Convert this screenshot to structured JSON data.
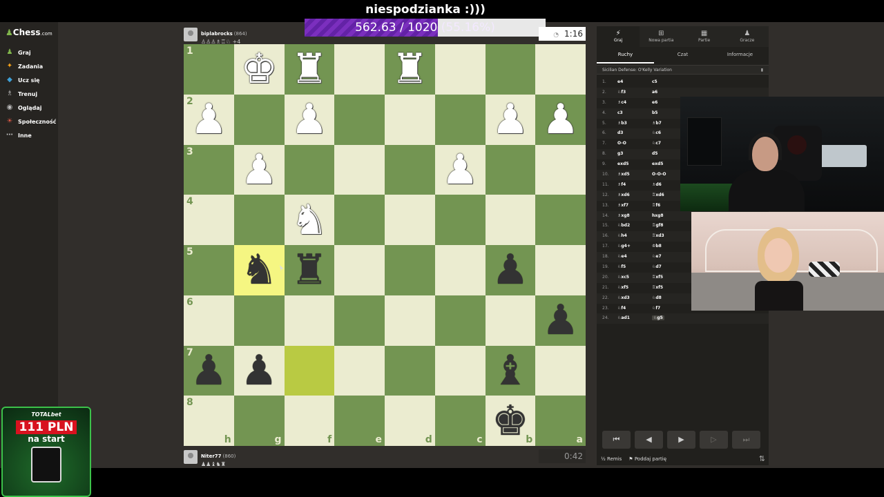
{
  "stream": {
    "caption": "niespodzianka :)))",
    "goal_text": "562.63 / 1020",
    "goal_pct": "(55.16%)",
    "goal_fraction": 0.5516
  },
  "sidebar": {
    "logo": "Chess",
    "logo_suffix": ".com",
    "items": [
      {
        "label": "Graj",
        "icon": "play-pawn-icon"
      },
      {
        "label": "Zadania",
        "icon": "puzzle-icon"
      },
      {
        "label": "Ucz się",
        "icon": "learn-icon"
      },
      {
        "label": "Trenuj",
        "icon": "train-icon"
      },
      {
        "label": "Oglądaj",
        "icon": "watch-icon"
      },
      {
        "label": "Społeczność",
        "icon": "community-icon"
      },
      {
        "label": "Inne",
        "icon": "more-icon"
      }
    ]
  },
  "ad": {
    "brand": "TOTALbet",
    "amount": "111 PLN",
    "sub": "na start"
  },
  "top_player": {
    "name": "biplabrocks",
    "rating": "(864)",
    "captured": "♙♙♙♗♖♘ +4",
    "clock": "1:16"
  },
  "bottom_player": {
    "name": "Niter77",
    "rating": "(860)",
    "captured": "♟♟♝♞♜",
    "clock": "0:42"
  },
  "board": {
    "ranks": [
      "1",
      "2",
      "3",
      "4",
      "5",
      "6",
      "7",
      "8"
    ],
    "files": [
      "h",
      "g",
      "f",
      "e",
      "d",
      "c",
      "b",
      "a"
    ],
    "rows": [
      [
        "",
        "wK",
        "wR",
        "",
        "wR",
        "",
        "",
        ""
      ],
      [
        "wP",
        "",
        "wP",
        "",
        "",
        "",
        "wP",
        "wP"
      ],
      [
        "",
        "wP",
        "",
        "",
        "",
        "wP",
        "",
        ""
      ],
      [
        "",
        "",
        "wN",
        "",
        "",
        "",
        "",
        ""
      ],
      [
        "",
        "bN",
        "bR",
        "",
        "",
        "",
        "bP",
        ""
      ],
      [
        "",
        "",
        "",
        "",
        "",
        "",
        "",
        "bP"
      ],
      [
        "bP",
        "bP",
        "",
        "",
        "",
        "",
        "bB",
        ""
      ],
      [
        "",
        "",
        "",
        "",
        "",
        "",
        "bK",
        ""
      ]
    ],
    "highlight": [
      [
        4,
        1
      ],
      [
        6,
        2
      ]
    ]
  },
  "panel": {
    "tabs": [
      {
        "label": "Graj",
        "icon": "bolt-icon"
      },
      {
        "label": "Nowa partia",
        "icon": "plus-icon"
      },
      {
        "label": "Partie",
        "icon": "board-icon"
      },
      {
        "label": "Gracze",
        "icon": "players-icon"
      }
    ],
    "subtabs": [
      "Ruchy",
      "Czat",
      "Informacje"
    ],
    "opening": "Sicilian Defense: O'Kelly Variation",
    "moves": [
      [
        "1.",
        "e4",
        "c5"
      ],
      [
        "2.",
        "♘f3",
        "a6"
      ],
      [
        "3.",
        "♗c4",
        "e6"
      ],
      [
        "4.",
        "c3",
        "b5"
      ],
      [
        "5.",
        "♗b3",
        "♗b7"
      ],
      [
        "6.",
        "d3",
        "♘c6"
      ],
      [
        "7.",
        "O-O",
        "♘c7"
      ],
      [
        "8.",
        "g3",
        "d5"
      ],
      [
        "9.",
        "exd5",
        "exd5"
      ],
      [
        "10.",
        "♗xd5",
        "O-O-O"
      ],
      [
        "11.",
        "♗f4",
        "♗d6"
      ],
      [
        "12.",
        "♗xd6",
        "♖xd6"
      ],
      [
        "13.",
        "♗xf7",
        "♖f6"
      ],
      [
        "14.",
        "♗xg8",
        "hxg8"
      ],
      [
        "15.",
        "♘bd2",
        "♖gf8"
      ],
      [
        "16.",
        "♘h4",
        "♖xd3"
      ],
      [
        "17.",
        "♘g4+",
        "♔b8"
      ],
      [
        "18.",
        "♘e4",
        "♘e7"
      ],
      [
        "19.",
        "♘f5",
        "♘d7"
      ],
      [
        "20.",
        "♘xc5",
        "♖xf5"
      ],
      [
        "21.",
        "♘xf5",
        "♖xf5"
      ],
      [
        "22.",
        "♘xd3",
        "♘d8"
      ],
      [
        "23.",
        "♘f4",
        "♘f7"
      ],
      [
        "24.",
        "♘ad1",
        "♘g5"
      ]
    ],
    "controls": [
      "⏮",
      "◀",
      "▶",
      "▷",
      "⏭"
    ],
    "draw_label": "Remis",
    "resign_label": "Poddaj partię"
  }
}
